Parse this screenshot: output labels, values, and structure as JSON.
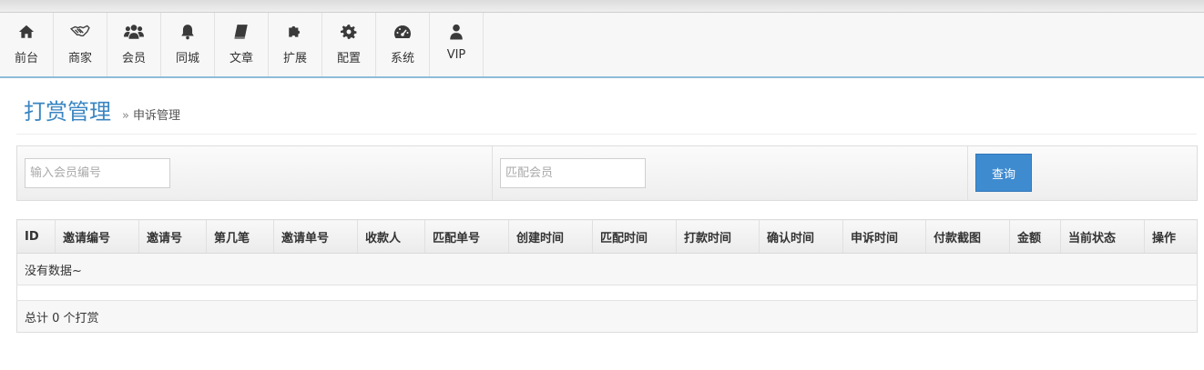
{
  "nav": {
    "items": [
      {
        "label": "前台",
        "icon": "home-icon"
      },
      {
        "label": "商家",
        "icon": "handshake-icon"
      },
      {
        "label": "会员",
        "icon": "users-icon"
      },
      {
        "label": "同城",
        "icon": "bell-icon"
      },
      {
        "label": "文章",
        "icon": "book-icon"
      },
      {
        "label": "扩展",
        "icon": "puzzle-icon"
      },
      {
        "label": "配置",
        "icon": "gear-icon"
      },
      {
        "label": "系统",
        "icon": "dashboard-icon"
      },
      {
        "label": "VIP",
        "icon": "user-icon"
      }
    ]
  },
  "header": {
    "title": "打赏管理",
    "breadcrumb_sep": "»",
    "breadcrumb": "申诉管理"
  },
  "filter": {
    "member_placeholder": "输入会员编号",
    "match_placeholder": "匹配会员",
    "query_label": "查询"
  },
  "table": {
    "columns": [
      "ID",
      "邀请编号",
      "邀请号",
      "第几笔",
      "邀请单号",
      "收款人",
      "匹配单号",
      "创建时间",
      "匹配时间",
      "打款时间",
      "确认时间",
      "申诉时间",
      "付款截图",
      "金额",
      "当前状态",
      "操作"
    ],
    "empty_text": "没有数据~",
    "total_text": "总计 0 个打赏"
  },
  "colors": {
    "accent": "#3a86c2",
    "button": "#3f8bd0"
  }
}
